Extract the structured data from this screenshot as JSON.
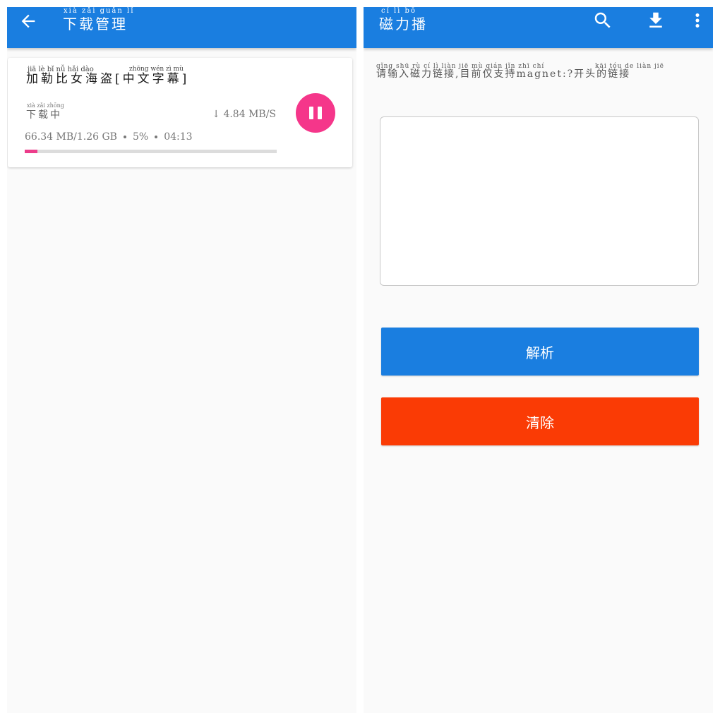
{
  "download_screen": {
    "title_pinyin": "xià  zǎi guǎn  lǐ",
    "title": "下载管理",
    "task": {
      "name_pinyin_1": "jiā   lè   bǐ   nǚ  hǎi  dào",
      "name_pinyin_2": "zhōng wén   zì   mù",
      "name": "加勒比女海盗[中文字幕]",
      "status_pinyin": "xià  zǎi zhōng",
      "status": "下载中",
      "speed": "↓ 4.84 MB/S",
      "size": "66.34 MB/1.26 GB",
      "percent": "5%",
      "eta": "04:13",
      "progress_fraction": 0.05
    }
  },
  "magnet_screen": {
    "title_pinyin": "cí   lì   bō",
    "title": "磁力播",
    "hint_pinyin_1": "qǐng shū  rù   cí    lì   liàn  jiē    mù  qián  jǐn  zhī  chí",
    "hint_pinyin_2": "kāi  tóu   de  liàn  jiē",
    "hint": "请输入磁力链接,目前仅支持magnet:?开头的链接",
    "input_value": "",
    "parse_label": "解析",
    "clear_label": "清除"
  },
  "colors": {
    "app_bar": "#1a7ee0",
    "accent_pink": "#f5368a",
    "clear_red": "#fa3b05"
  },
  "icons": [
    "back-arrow-icon",
    "pause-icon",
    "search-icon",
    "download-icon",
    "more-vert-icon"
  ]
}
